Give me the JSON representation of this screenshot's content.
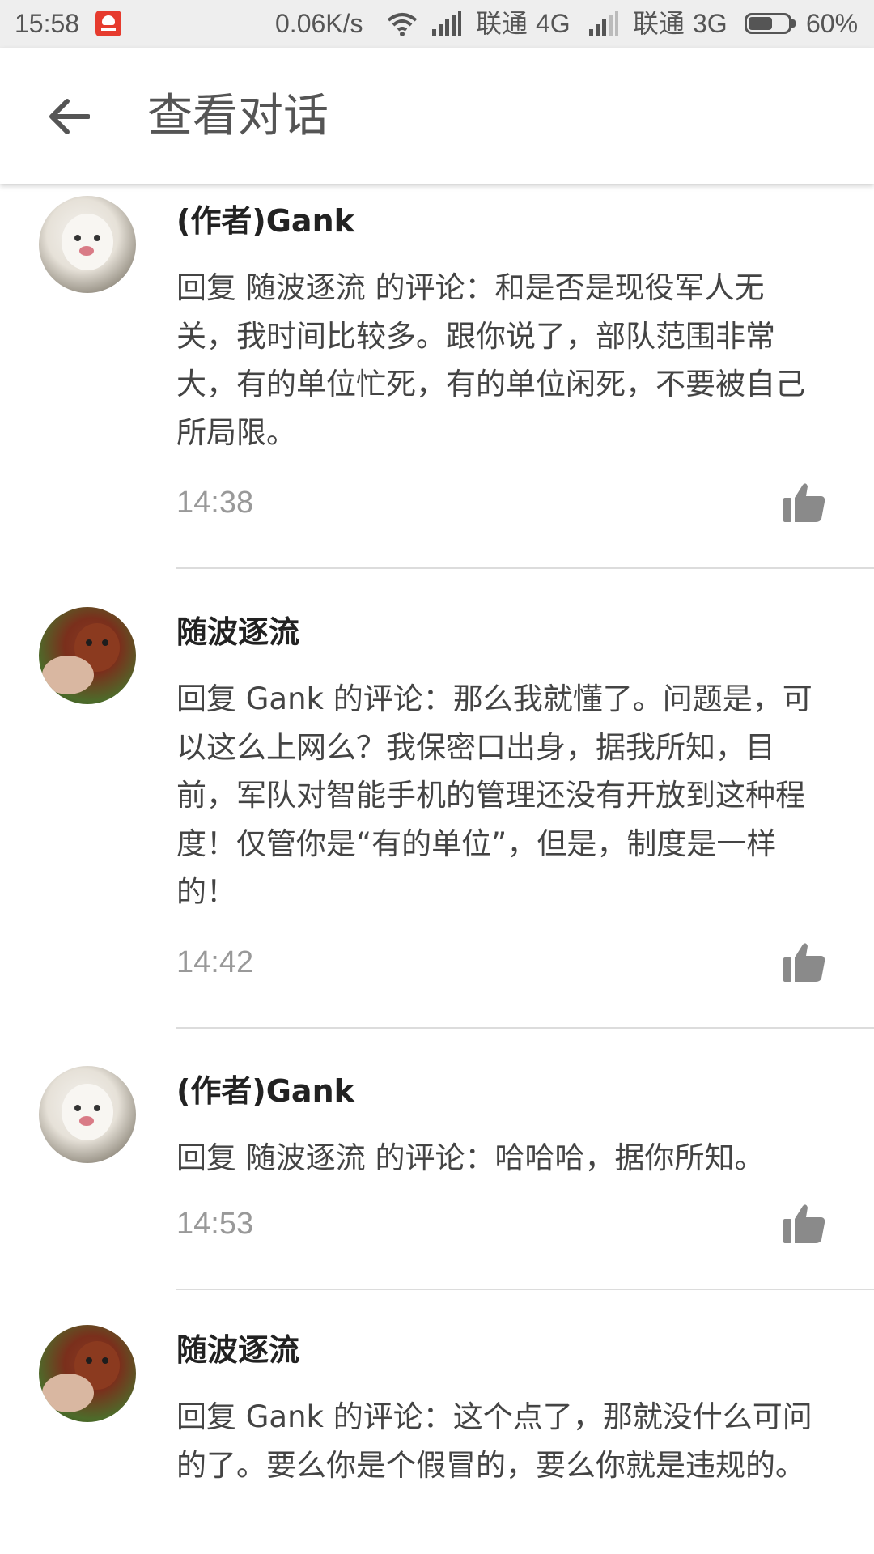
{
  "status_bar": {
    "time": "15:58",
    "speed": "0.06K/s",
    "carrier1": "联通",
    "net1": "4G",
    "carrier2": "联通",
    "net2": "3G",
    "battery": "60%",
    "battery_level": 0.6
  },
  "header": {
    "title": "查看对话",
    "back_icon": "arrow-left-icon"
  },
  "comments": [
    {
      "author": "(作者)Gank",
      "avatar": "white-poodle-avatar",
      "text": "回复 随波逐流 的评论：和是否是现役军人无关，我时间比较多。跟你说了，部队范围非常大，有的单位忙死，有的单位闲死，不要被自己所局限。",
      "time": "14:38"
    },
    {
      "author": "随波逐流",
      "avatar": "brown-poodle-avatar",
      "text": "回复 Gank 的评论：那么我就懂了。问题是，可以这么上网么？我保密口出身，据我所知，目前，军队对智能手机的管理还没有开放到这种程度！仅管你是“有的单位”，但是，制度是一样的！",
      "time": "14:42"
    },
    {
      "author": "(作者)Gank",
      "avatar": "white-poodle-avatar",
      "text": "回复 随波逐流 的评论：哈哈哈，据你所知。",
      "time": "14:53"
    },
    {
      "author": "随波逐流",
      "avatar": "brown-poodle-avatar",
      "text": "回复 Gank 的评论：这个点了，那就没什么可问的了。要么你是个假冒的，要么你就是违规的。",
      "time": ""
    }
  ]
}
